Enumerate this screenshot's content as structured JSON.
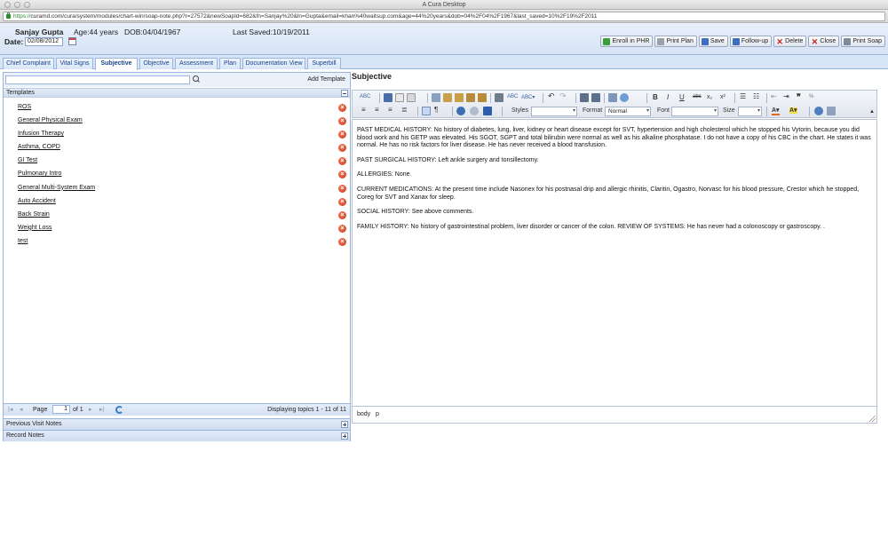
{
  "window": {
    "title": "A Cura Desktop"
  },
  "url": {
    "scheme": "https://",
    "rest": "curamd.com/cura/system/modules/chart-win/soap-note.php?r=27572&newSoapId=682&fn=Sanjay%20&ln=Gupta&email=khan%40waitsup.com&age=44%20years&dob=04%2F04%2F1967&last_saved=10%2F19%2F2011"
  },
  "patient": {
    "name": "Sanjay Gupta",
    "age": "Age:44 years",
    "dob": "DOB:04/04/1967",
    "last_saved": "Last Saved:10/19/2011",
    "date_label": "Date:",
    "date_value": "02/08/2012"
  },
  "actions": [
    "Enroll in PHR",
    "Print Plan",
    "Save",
    "Follow-up",
    "Delete",
    "Close",
    "Print Soap"
  ],
  "tabs": [
    "Chief Complaint",
    "Vital Signs",
    "Subjective",
    "Objective",
    "Assessment",
    "Plan",
    "Documentation View",
    "Superbill"
  ],
  "left": {
    "add_template": "Add Template",
    "templates_header": "Templates",
    "templates": [
      "ROS",
      "General Physical Exam",
      "Infusion Therapy",
      "Asthma, COPD",
      "GI Test",
      "Pulmonary Intro",
      "General Multi-System Exam",
      "Auto Accident",
      "Back Strain",
      "Weight Loss",
      "test"
    ],
    "pager": {
      "page_label": "Page",
      "page_value": "1",
      "of": "of 1",
      "display": "Displaying topics 1 - 11 of 11"
    },
    "previous_visit_notes": "Previous Visit Notes",
    "record_notes": "Record Notes"
  },
  "editor": {
    "title": "Subjective",
    "styles_label": "Styles",
    "format_label": "Format",
    "format_value": "Normal",
    "font_label": "Font",
    "size_label": "Size",
    "paragraphs": [
      "PAST MEDICAL HISTORY: No history of diabetes, lung, liver, kidney or heart disease except for SVT, hypertension and high cholesterol which he stopped his Vytorin, because you did blood work and his GETP was elevated. His SGOT, SGPT and total bilirubin were normal as well as his alkaline phosphatase. I do not have a copy of his CBC in the chart. He states it was normal. He has no risk factors for liver disease. He has never received a blood transfusion.",
      "PAST SURGICAL HISTORY: Left ankle surgery and tonsillectomy.",
      "ALLERGIES: None.",
      "CURRENT MEDICATIONS: At the present time include Nasonex for his postnasal drip and allergic rhinitis, Claritin, Ogastro, Norvasc for his blood pressure, Crestor which he stopped, Coreg for SVT and Xanax for sleep.",
      "SOCIAL HISTORY: See above comments.",
      "FAMILY HISTORY: No history of gastrointestinal problem, liver disorder or cancer of the colon. REVIEW OF SYSTEMS: He has never had a colonoscopy or gastroscopy. ."
    ],
    "path": "body   p"
  },
  "colors": {
    "accent": "#15428b",
    "header_bg": "#d6e3f5",
    "delete_red": "#c9391c"
  }
}
